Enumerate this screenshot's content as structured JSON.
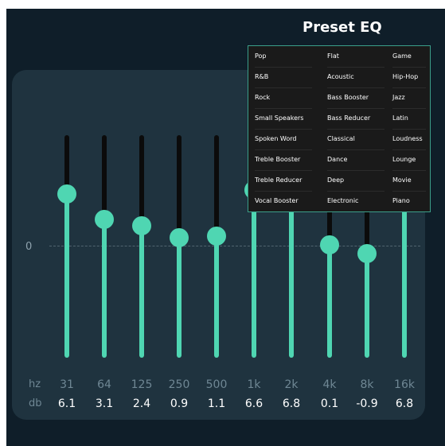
{
  "title": "Preset EQ",
  "zero_label": "0",
  "axis": {
    "hz_label": "hz",
    "db_label": "db"
  },
  "colors": {
    "background": "#0f1e29",
    "panel": "#1f333f",
    "accent": "#4fd6b2",
    "track": "#0b0b0b",
    "menu": "#1a1a1a",
    "menu_border": "#3b9f8a"
  },
  "bands": [
    {
      "hz": "31",
      "db": "6.1"
    },
    {
      "hz": "64",
      "db": "3.1"
    },
    {
      "hz": "125",
      "db": "2.4"
    },
    {
      "hz": "250",
      "db": "0.9"
    },
    {
      "hz": "500",
      "db": "1.1"
    },
    {
      "hz": "1k",
      "db": "6.6"
    },
    {
      "hz": "2k",
      "db": "6.8"
    },
    {
      "hz": "4k",
      "db": "0.1"
    },
    {
      "hz": "8k",
      "db": "-0.9"
    },
    {
      "hz": "16k",
      "db": "6.8"
    }
  ],
  "presets": {
    "col1": [
      "Pop",
      "R&B",
      "Rock",
      "Small Speakers",
      "Spoken Word",
      "Treble Booster",
      "Treble Reducer",
      "Vocal Booster"
    ],
    "col2": [
      "Flat",
      "Acoustic",
      "Bass Booster",
      "Bass Reducer",
      "Classical",
      "Dance",
      "Deep",
      "Electronic"
    ],
    "col3": [
      "Game",
      "Hip-Hop",
      "Jazz",
      "Latin",
      "Loudness",
      "Lounge",
      "Movie",
      "Piano"
    ]
  }
}
